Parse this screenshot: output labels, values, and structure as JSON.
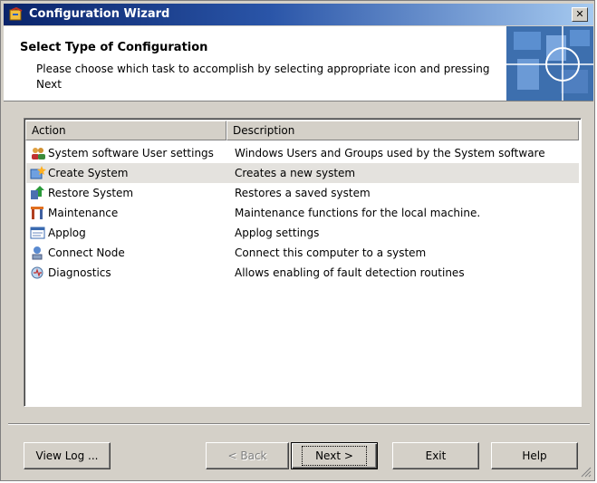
{
  "window": {
    "title": "Configuration Wizard",
    "close_glyph": "✕"
  },
  "header": {
    "title": "Select Type of Configuration",
    "description": "Please choose which task to accomplish by selecting appropriate icon and pressing Next"
  },
  "list": {
    "columns": [
      "Action",
      "Description"
    ],
    "rows": [
      {
        "icon": "users-icon",
        "action": "System software User settings",
        "description": "Windows Users and Groups used by the System software",
        "selected": false
      },
      {
        "icon": "create-system-icon",
        "action": "Create System",
        "description": "Creates a new system",
        "selected": true
      },
      {
        "icon": "restore-icon",
        "action": "Restore System",
        "description": "Restores a saved system",
        "selected": false
      },
      {
        "icon": "maintenance-icon",
        "action": "Maintenance",
        "description": "Maintenance functions for the local machine.",
        "selected": false
      },
      {
        "icon": "applog-icon",
        "action": "Applog",
        "description": "Applog settings",
        "selected": false
      },
      {
        "icon": "connect-node-icon",
        "action": "Connect Node",
        "description": "Connect this computer to a system",
        "selected": false
      },
      {
        "icon": "diagnostics-icon",
        "action": "Diagnostics",
        "description": "Allows enabling of fault detection routines",
        "selected": false
      }
    ]
  },
  "buttons": {
    "view_log": "View Log ...",
    "back": "< Back",
    "next": "Next >",
    "exit": "Exit",
    "help": "Help"
  }
}
